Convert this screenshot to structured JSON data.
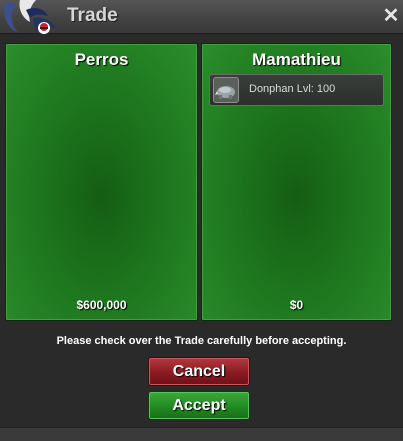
{
  "window": {
    "title": "Trade"
  },
  "left_panel": {
    "player": "Perros",
    "money": "$600,000"
  },
  "right_panel": {
    "player": "Mamathieu",
    "money": "$0",
    "items": [
      {
        "label": "Donphan  Lvl: 100",
        "icon": "donphan-icon"
      }
    ]
  },
  "notice": "Please check over the Trade carefully before accepting.",
  "buttons": {
    "cancel": "Cancel",
    "accept": "Accept"
  },
  "colors": {
    "cancel": "#8a1b22",
    "accept": "#228a22",
    "panel": "#1d751d"
  }
}
